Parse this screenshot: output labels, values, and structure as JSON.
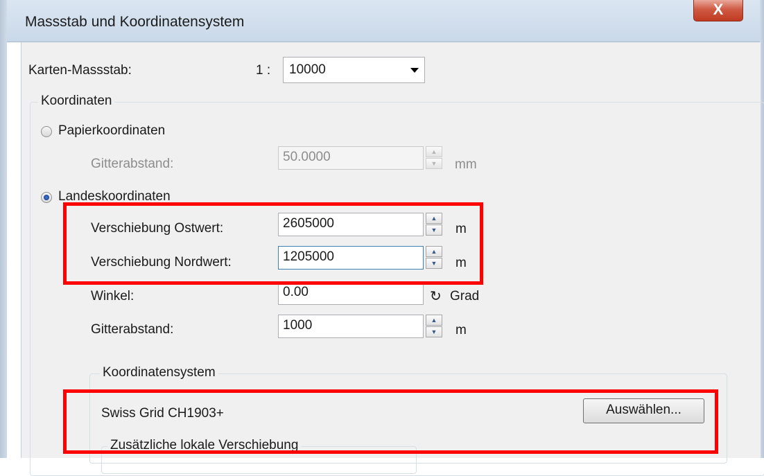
{
  "window": {
    "title": "Massstab und Koordinatensystem",
    "close_label": "X"
  },
  "scale": {
    "label": "Karten-Massstab:",
    "prefix": "1 :",
    "value": "10000"
  },
  "coordinates": {
    "group_title": "Koordinaten",
    "paper": {
      "label": "Papierkoordinaten",
      "selected": false,
      "grid_label": "Gitterabstand:",
      "grid_value": "50.0000",
      "grid_unit": "mm"
    },
    "national": {
      "label": "Landeskoordinaten",
      "selected": true,
      "east_label": "Verschiebung Ostwert:",
      "east_value": "2605000",
      "east_unit": "m",
      "north_label": "Verschiebung Nordwert:",
      "north_value": "1205000",
      "north_unit": "m",
      "angle_label": "Winkel:",
      "angle_value": "0.00",
      "angle_unit": "Grad",
      "angle_icon": "rotate-icon",
      "grid_label": "Gitterabstand:",
      "grid_value": "1000",
      "grid_unit": "m"
    }
  },
  "coordinate_system": {
    "group_title": "Koordinatensystem",
    "name": "Swiss Grid  CH1903+",
    "select_button": "Auswählen..."
  },
  "local_shift": {
    "group_title": "Zusätzliche lokale Verschiebung"
  },
  "colors": {
    "highlight": "#ff0000",
    "close_button": "#c9452e"
  }
}
